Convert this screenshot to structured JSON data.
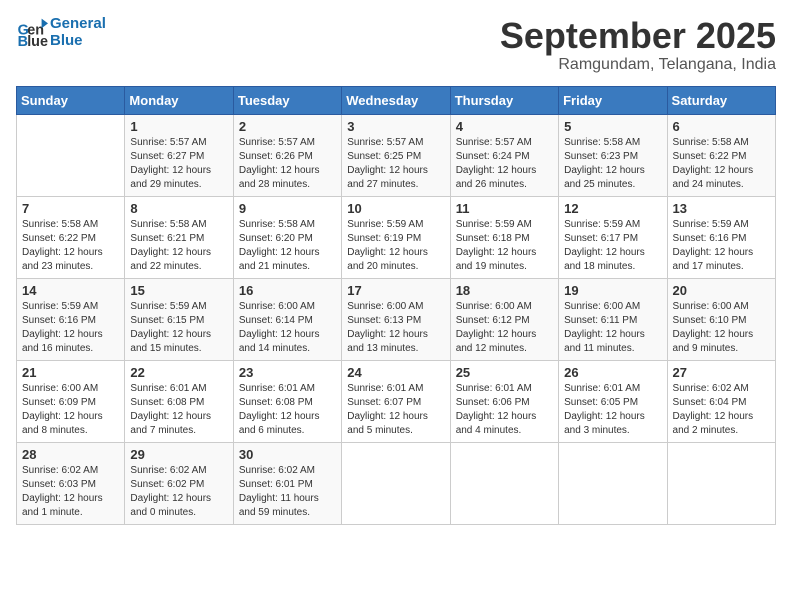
{
  "header": {
    "logo_line1": "General",
    "logo_line2": "Blue",
    "month": "September 2025",
    "location": "Ramgundam, Telangana, India"
  },
  "days_of_week": [
    "Sunday",
    "Monday",
    "Tuesday",
    "Wednesday",
    "Thursday",
    "Friday",
    "Saturday"
  ],
  "weeks": [
    [
      {
        "day": "",
        "info": ""
      },
      {
        "day": "1",
        "info": "Sunrise: 5:57 AM\nSunset: 6:27 PM\nDaylight: 12 hours\nand 29 minutes."
      },
      {
        "day": "2",
        "info": "Sunrise: 5:57 AM\nSunset: 6:26 PM\nDaylight: 12 hours\nand 28 minutes."
      },
      {
        "day": "3",
        "info": "Sunrise: 5:57 AM\nSunset: 6:25 PM\nDaylight: 12 hours\nand 27 minutes."
      },
      {
        "day": "4",
        "info": "Sunrise: 5:57 AM\nSunset: 6:24 PM\nDaylight: 12 hours\nand 26 minutes."
      },
      {
        "day": "5",
        "info": "Sunrise: 5:58 AM\nSunset: 6:23 PM\nDaylight: 12 hours\nand 25 minutes."
      },
      {
        "day": "6",
        "info": "Sunrise: 5:58 AM\nSunset: 6:22 PM\nDaylight: 12 hours\nand 24 minutes."
      }
    ],
    [
      {
        "day": "7",
        "info": "Sunrise: 5:58 AM\nSunset: 6:22 PM\nDaylight: 12 hours\nand 23 minutes."
      },
      {
        "day": "8",
        "info": "Sunrise: 5:58 AM\nSunset: 6:21 PM\nDaylight: 12 hours\nand 22 minutes."
      },
      {
        "day": "9",
        "info": "Sunrise: 5:58 AM\nSunset: 6:20 PM\nDaylight: 12 hours\nand 21 minutes."
      },
      {
        "day": "10",
        "info": "Sunrise: 5:59 AM\nSunset: 6:19 PM\nDaylight: 12 hours\nand 20 minutes."
      },
      {
        "day": "11",
        "info": "Sunrise: 5:59 AM\nSunset: 6:18 PM\nDaylight: 12 hours\nand 19 minutes."
      },
      {
        "day": "12",
        "info": "Sunrise: 5:59 AM\nSunset: 6:17 PM\nDaylight: 12 hours\nand 18 minutes."
      },
      {
        "day": "13",
        "info": "Sunrise: 5:59 AM\nSunset: 6:16 PM\nDaylight: 12 hours\nand 17 minutes."
      }
    ],
    [
      {
        "day": "14",
        "info": "Sunrise: 5:59 AM\nSunset: 6:16 PM\nDaylight: 12 hours\nand 16 minutes."
      },
      {
        "day": "15",
        "info": "Sunrise: 5:59 AM\nSunset: 6:15 PM\nDaylight: 12 hours\nand 15 minutes."
      },
      {
        "day": "16",
        "info": "Sunrise: 6:00 AM\nSunset: 6:14 PM\nDaylight: 12 hours\nand 14 minutes."
      },
      {
        "day": "17",
        "info": "Sunrise: 6:00 AM\nSunset: 6:13 PM\nDaylight: 12 hours\nand 13 minutes."
      },
      {
        "day": "18",
        "info": "Sunrise: 6:00 AM\nSunset: 6:12 PM\nDaylight: 12 hours\nand 12 minutes."
      },
      {
        "day": "19",
        "info": "Sunrise: 6:00 AM\nSunset: 6:11 PM\nDaylight: 12 hours\nand 11 minutes."
      },
      {
        "day": "20",
        "info": "Sunrise: 6:00 AM\nSunset: 6:10 PM\nDaylight: 12 hours\nand 9 minutes."
      }
    ],
    [
      {
        "day": "21",
        "info": "Sunrise: 6:00 AM\nSunset: 6:09 PM\nDaylight: 12 hours\nand 8 minutes."
      },
      {
        "day": "22",
        "info": "Sunrise: 6:01 AM\nSunset: 6:08 PM\nDaylight: 12 hours\nand 7 minutes."
      },
      {
        "day": "23",
        "info": "Sunrise: 6:01 AM\nSunset: 6:08 PM\nDaylight: 12 hours\nand 6 minutes."
      },
      {
        "day": "24",
        "info": "Sunrise: 6:01 AM\nSunset: 6:07 PM\nDaylight: 12 hours\nand 5 minutes."
      },
      {
        "day": "25",
        "info": "Sunrise: 6:01 AM\nSunset: 6:06 PM\nDaylight: 12 hours\nand 4 minutes."
      },
      {
        "day": "26",
        "info": "Sunrise: 6:01 AM\nSunset: 6:05 PM\nDaylight: 12 hours\nand 3 minutes."
      },
      {
        "day": "27",
        "info": "Sunrise: 6:02 AM\nSunset: 6:04 PM\nDaylight: 12 hours\nand 2 minutes."
      }
    ],
    [
      {
        "day": "28",
        "info": "Sunrise: 6:02 AM\nSunset: 6:03 PM\nDaylight: 12 hours\nand 1 minute."
      },
      {
        "day": "29",
        "info": "Sunrise: 6:02 AM\nSunset: 6:02 PM\nDaylight: 12 hours\nand 0 minutes."
      },
      {
        "day": "30",
        "info": "Sunrise: 6:02 AM\nSunset: 6:01 PM\nDaylight: 11 hours\nand 59 minutes."
      },
      {
        "day": "",
        "info": ""
      },
      {
        "day": "",
        "info": ""
      },
      {
        "day": "",
        "info": ""
      },
      {
        "day": "",
        "info": ""
      }
    ]
  ]
}
